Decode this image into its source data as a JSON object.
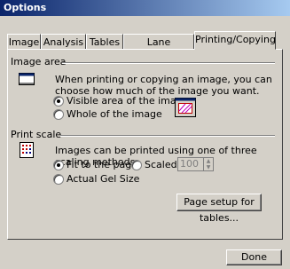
{
  "window": {
    "title": "Options"
  },
  "tabs": [
    {
      "label": "Image",
      "active": false
    },
    {
      "label": "Analysis",
      "active": false
    },
    {
      "label": "Tables",
      "active": false
    },
    {
      "label": "Lane Selection",
      "active": false
    },
    {
      "label": "Printing/Copying",
      "active": true
    }
  ],
  "image_area": {
    "heading": "Image area",
    "description": "When printing or copying an image, you can choose how much of the image you want.",
    "options": [
      {
        "label": "Visible area of the image",
        "selected": true
      },
      {
        "label": "Whole of the image",
        "selected": false
      }
    ]
  },
  "print_scale": {
    "heading": "Print scale",
    "description": "Images can be printed using one of three scaling methods.",
    "options": [
      {
        "label": "Fit to the page",
        "selected": true
      },
      {
        "label": "Scaled",
        "selected": false
      },
      {
        "label": "Actual Gel Size",
        "selected": false
      }
    ],
    "scaled_value": "100"
  },
  "buttons": {
    "page_setup": "Page setup for tables...",
    "done": "Done"
  },
  "icons": {
    "image_area_icon": "window-icon",
    "preview_icon": "image-preview-icon",
    "print_scale_icon": "grid-icon"
  }
}
